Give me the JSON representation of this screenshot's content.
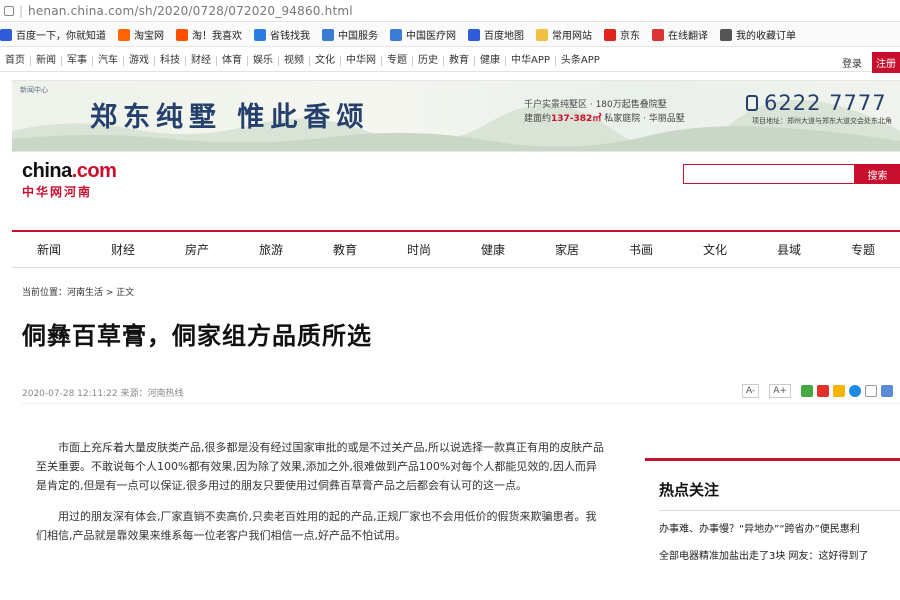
{
  "browser": {
    "url": "henan.china.com/sh/2020/0728/072020_94860.html",
    "bookmarks": [
      {
        "label": "百度一下，你就知道",
        "icon": "paw-icon",
        "color": "#2f5bd8"
      },
      {
        "label": "淘宝网",
        "icon": "taobao-icon",
        "color": "#ff6600"
      },
      {
        "label": "淘！我喜欢",
        "icon": "generic-icon",
        "color": "#ff5000"
      },
      {
        "label": "省钱找我",
        "icon": "blue-square-icon",
        "color": "#2a7de1"
      },
      {
        "label": "中国服务",
        "icon": "circle-icon",
        "color": "#3a7bd5"
      },
      {
        "label": "中国医疗网",
        "icon": "circle-icon",
        "color": "#3a7bd5"
      },
      {
        "label": "百度地图",
        "icon": "paw-icon",
        "color": "#2f5bd8"
      },
      {
        "label": "常用网站",
        "icon": "folder-icon",
        "color": "#f0c040"
      },
      {
        "label": "京东",
        "icon": "red-square-icon",
        "color": "#e1251b"
      },
      {
        "label": "在线翻译",
        "icon": "circle-icon",
        "color": "#d33"
      },
      {
        "label": "我的收藏订单",
        "icon": "circle-icon",
        "color": "#555"
      }
    ]
  },
  "toplinks": {
    "items": [
      "首页",
      "新闻",
      "军事",
      "汽车",
      "游戏",
      "科技",
      "财经",
      "体育",
      "娱乐",
      "视频",
      "文化",
      "中华网",
      "专题",
      "历史",
      "教育",
      "健康",
      "中华APP",
      "头条APP"
    ],
    "login": "登录",
    "register": "注册"
  },
  "banner": {
    "mini_logo": "新闻中心",
    "title": "郑东纯墅 惟此香颂",
    "info1": "千户实景纯墅区 · 180万起售叠院墅",
    "info2_prefix": "建面约",
    "info2_price": "137-382㎡",
    "info2_suffix": " 私家庭院 · 华丽品墅",
    "phone": "6222 7777",
    "address": "项目地址：郑州大道与郑东大道交会处东北角"
  },
  "site": {
    "logo_main": "china",
    "logo_dot": ".com",
    "logo_sub": "中华网河南",
    "search_button": "搜索"
  },
  "nav": [
    "新闻",
    "财经",
    "房产",
    "旅游",
    "教育",
    "时尚",
    "健康",
    "家居",
    "书画",
    "文化",
    "县域",
    "专题"
  ],
  "breadcrumb": "当前位置：河南生活 > 正文",
  "article": {
    "title": "侗彝百草膏，侗家组方品质所选",
    "meta": "2020-07-28 12:11:22 来源：河南热线",
    "font_small": "A-",
    "font_large": "A+",
    "paragraphs": [
      "市面上充斥着大量皮肤类产品,很多都是没有经过国家审批的或是不过关产品,所以说选择一款真正有用的皮肤产品至关重要。不敢说每个人100%都有效果,因为除了效果,添加之外,很难做到产品100%对每个人都能见效的,因人而异是肯定的,但是有一点可以保证,很多用过的朋友只要使用过侗彝百草膏产品之后都会有认可的这一点。",
      "用过的朋友深有体会,厂家直销不卖高价,只卖老百姓用的起的产品,正规厂家也不会用低价的假货来欺骗患者。我们相信,产品就是靠效果来维系每一位老客户我们相信一点,好产品不怕试用。"
    ]
  },
  "sidebar": {
    "title": "热点关注",
    "items": [
      "办事难、办事慢？“异地办”“跨省办”便民惠利",
      "全部电器精准加盐出走了3块 网友：这好得到了"
    ]
  },
  "colors": {
    "accent": "#c8102e",
    "banner_blue": "#26406d"
  }
}
